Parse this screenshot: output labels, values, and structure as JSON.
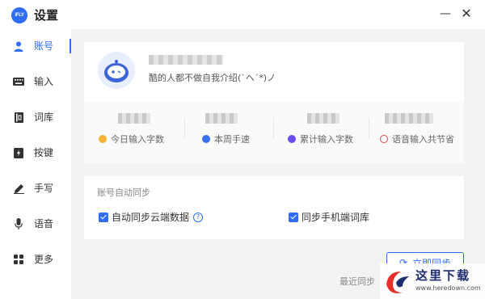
{
  "app": {
    "logo_text": "iFLY",
    "title": "设置"
  },
  "window": {
    "minimize": "—",
    "close": "✕"
  },
  "sidebar": {
    "active_color": "#2f6df6",
    "items": [
      {
        "label": "账号",
        "icon": "user-icon",
        "active": true
      },
      {
        "label": "输入",
        "icon": "keyboard-icon"
      },
      {
        "label": "词库",
        "icon": "book-icon"
      },
      {
        "label": "按键",
        "icon": "key-icon"
      },
      {
        "label": "手写",
        "icon": "pen-icon"
      },
      {
        "label": "语音",
        "icon": "microphone-icon"
      },
      {
        "label": "更多",
        "icon": "grid-icon"
      }
    ]
  },
  "profile": {
    "bio": "酷的人都不做自我介绍(`へ´*)ノ"
  },
  "stats": [
    {
      "label": "今日输入字数",
      "color": "#f5b335"
    },
    {
      "label": "本周手速",
      "color": "#3b6ff0"
    },
    {
      "label": "累计输入字数",
      "color": "#6a4cf0"
    },
    {
      "label": "语音输入共节省",
      "color": "#e84545"
    }
  ],
  "sync": {
    "title": "账号自动同步",
    "cloud_data": "自动同步云端数据",
    "help": "?",
    "phone_lexicon": "同步手机端词库",
    "sync_now": "立即同步",
    "last_sync": "最近同步"
  },
  "watermark": {
    "text": "这里下载",
    "url": "www.heredown.com"
  }
}
